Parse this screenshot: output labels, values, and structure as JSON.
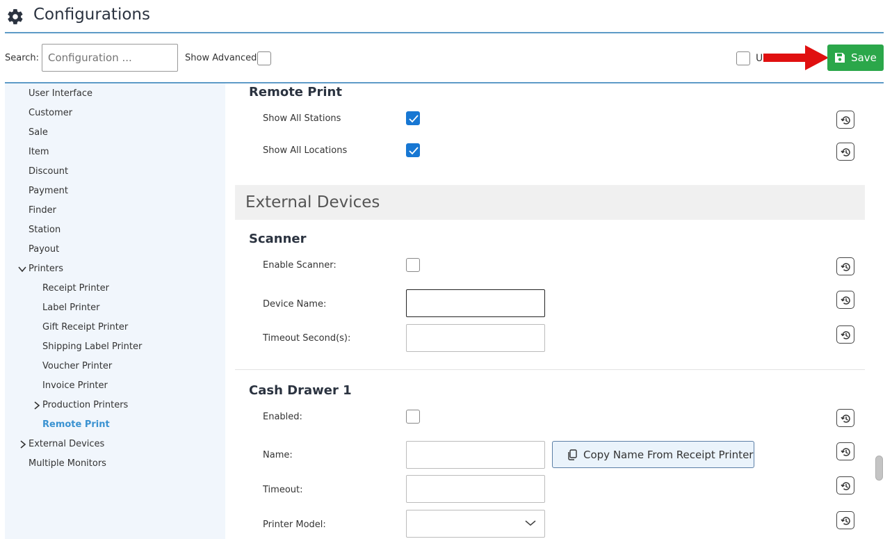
{
  "header": {
    "title": "Configurations",
    "icon": "gear-icon"
  },
  "toolbar": {
    "search_label": "Search:",
    "search_placeholder": "Configuration ...",
    "show_advanced_label": "Show Advanced",
    "show_advanced_checked": false,
    "u_label": "U",
    "save_label": "Save"
  },
  "sidebar": {
    "items": [
      {
        "label": "User Interface"
      },
      {
        "label": "Customer"
      },
      {
        "label": "Sale"
      },
      {
        "label": "Item"
      },
      {
        "label": "Discount"
      },
      {
        "label": "Payment"
      },
      {
        "label": "Finder"
      },
      {
        "label": "Station"
      },
      {
        "label": "Payout"
      },
      {
        "label": "Printers",
        "expanded": true
      },
      {
        "label": "Receipt Printer"
      },
      {
        "label": "Label Printer"
      },
      {
        "label": "Gift Receipt Printer"
      },
      {
        "label": "Shipping Label Printer"
      },
      {
        "label": "Voucher Printer"
      },
      {
        "label": "Invoice Printer"
      },
      {
        "label": "Production Printers",
        "expanded": false
      },
      {
        "label": "Remote Print",
        "active": true
      },
      {
        "label": "External Devices",
        "expanded": false
      },
      {
        "label": "Multiple Monitors"
      }
    ]
  },
  "remote_print": {
    "title": "Remote Print",
    "show_all_stations": {
      "label": "Show All Stations",
      "checked": true
    },
    "show_all_locations": {
      "label": "Show All Locations",
      "checked": true
    }
  },
  "external_devices": {
    "header": "External Devices",
    "scanner": {
      "title": "Scanner",
      "enable_label": "Enable Scanner:",
      "enable_checked": false,
      "device_name_label": "Device Name:",
      "device_name_value": "",
      "timeout_label": "Timeout Second(s):",
      "timeout_value": ""
    },
    "cash_drawer": {
      "title": "Cash Drawer 1",
      "enabled_label": "Enabled:",
      "enabled_checked": false,
      "name_label": "Name:",
      "name_value": "",
      "copy_button_label": "Copy Name From Receipt Printer",
      "timeout_label": "Timeout:",
      "timeout_value": "",
      "printer_model_label": "Printer Model:",
      "printer_model_value": ""
    }
  },
  "colors": {
    "accent_line": "#5d9ac7",
    "save_button": "#2ba74a",
    "checkbox_checked": "#1777d3",
    "active_nav": "#3a92d1",
    "annotation_arrow": "#e01010"
  }
}
